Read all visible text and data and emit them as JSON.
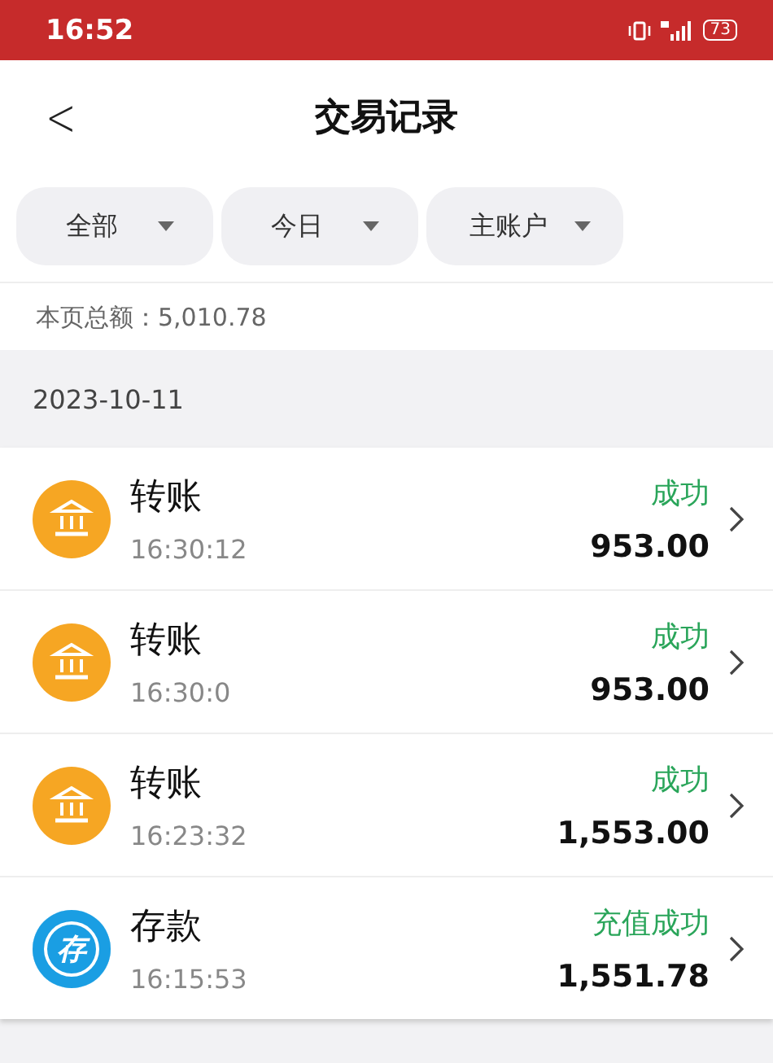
{
  "status_bar": {
    "time": "16:52",
    "battery": "73"
  },
  "header": {
    "back": "<",
    "title": "交易记录"
  },
  "filters": [
    {
      "label": "全部"
    },
    {
      "label": "今日"
    },
    {
      "label": "主账户"
    }
  ],
  "summary": "本页总额：5,010.78",
  "date": "2023-10-11",
  "transactions": [
    {
      "kind": "transfer",
      "title": "转账",
      "time": "16:30:12",
      "status": "成功",
      "amount": "953.00"
    },
    {
      "kind": "transfer",
      "title": "转账",
      "time": "16:30:0",
      "status": "成功",
      "amount": "953.00"
    },
    {
      "kind": "transfer",
      "title": "转账",
      "time": "16:23:32",
      "status": "成功",
      "amount": "1,553.00"
    },
    {
      "kind": "deposit",
      "icon_text": "存",
      "title": "存款",
      "time": "16:15:53",
      "status": "充值成功",
      "amount": "1,551.78"
    }
  ]
}
